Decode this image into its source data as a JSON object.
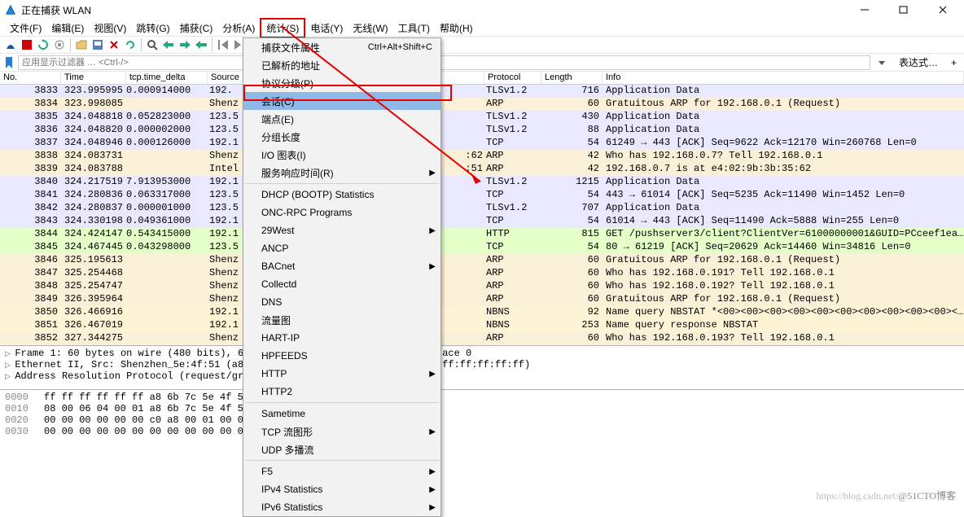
{
  "title": "正在捕获 WLAN",
  "menus": {
    "file": "文件(F)",
    "edit": "编辑(E)",
    "view": "视图(V)",
    "jump": "跳转(G)",
    "capture": "捕获(C)",
    "analyze": "分析(A)",
    "stats": "统计(S)",
    "telephony": "电话(Y)",
    "wireless": "无线(W)",
    "tools": "工具(T)",
    "help": "帮助(H)"
  },
  "filter_placeholder": "应用显示过滤器 … <Ctrl-/>",
  "expr_btn": "表达式…",
  "columns": {
    "no": "No.",
    "time": "Time",
    "delta": "tcp.time_delta",
    "src": "Source",
    "proto": "Protocol",
    "len": "Length",
    "info": "Info"
  },
  "dropdown": [
    {
      "label": "捕获文件属性",
      "shortcut": "Ctrl+Alt+Shift+C"
    },
    {
      "label": "已解析的地址"
    },
    {
      "label": "协议分级(P)"
    },
    {
      "label": "会话(C)",
      "sel": true,
      "hl": true
    },
    {
      "label": "端点(E)"
    },
    {
      "label": "分组长度"
    },
    {
      "label": "I/O 图表(I)"
    },
    {
      "label": "服务响应时间(R)",
      "sub": true,
      "sep_after": true
    },
    {
      "label": "DHCP (BOOTP) Statistics"
    },
    {
      "label": "ONC-RPC Programs"
    },
    {
      "label": "29West",
      "sub": true
    },
    {
      "label": "ANCP"
    },
    {
      "label": "BACnet",
      "sub": true
    },
    {
      "label": "Collectd"
    },
    {
      "label": "DNS"
    },
    {
      "label": "流量图"
    },
    {
      "label": "HART-IP"
    },
    {
      "label": "HPFEEDS"
    },
    {
      "label": "HTTP",
      "sub": true
    },
    {
      "label": "HTTP2"
    },
    {
      "label": "Sametime",
      "sep_before": true
    },
    {
      "label": "TCP 流图形",
      "sub": true
    },
    {
      "label": "UDP 多播流"
    },
    {
      "label": "F5",
      "sub": true,
      "sep_before": true
    },
    {
      "label": "IPv4 Statistics",
      "sub": true
    },
    {
      "label": "IPv6 Statistics",
      "sub": true
    }
  ],
  "rows": [
    {
      "no": "3833",
      "time": "323.995995",
      "delta": "0.000914000",
      "src": "192.",
      "srctail": "",
      "proto": "TLSv1.2",
      "len": "716",
      "info": "Application Data",
      "cls": "bg-tls"
    },
    {
      "no": "3834",
      "time": "323.998085",
      "delta": "",
      "src": "Shenz",
      "srctail": "",
      "proto": "ARP",
      "len": "60",
      "info": "Gratuitous ARP for 192.168.0.1 (Request)",
      "cls": "bg-arp"
    },
    {
      "no": "3835",
      "time": "324.048818",
      "delta": "0.052823000",
      "src": "123.5",
      "srctail": "",
      "proto": "TLSv1.2",
      "len": "430",
      "info": "Application Data",
      "cls": "bg-tls"
    },
    {
      "no": "3836",
      "time": "324.048820",
      "delta": "0.000002000",
      "src": "123.5",
      "srctail": "",
      "proto": "TLSv1.2",
      "len": "88",
      "info": "Application Data",
      "cls": "bg-tls"
    },
    {
      "no": "3837",
      "time": "324.048946",
      "delta": "0.000126000",
      "src": "192.1",
      "srctail": "",
      "proto": "TCP",
      "len": "54",
      "info": "61249 → 443 [ACK] Seq=9622 Ack=12170 Win=260768 Len=0",
      "cls": "bg-tcp"
    },
    {
      "no": "3838",
      "time": "324.083731",
      "delta": "",
      "src": "Shenz",
      "srctail": ":62",
      "proto": "ARP",
      "len": "42",
      "info": "Who has 192.168.0.7? Tell 192.168.0.1",
      "cls": "bg-arp"
    },
    {
      "no": "3839",
      "time": "324.083788",
      "delta": "",
      "src": "Intel",
      "srctail": ":51",
      "proto": "ARP",
      "len": "42",
      "info": "192.168.0.7 is at e4:02:9b:3b:35:62",
      "cls": "bg-arp"
    },
    {
      "no": "3840",
      "time": "324.217519",
      "delta": "7.913953000",
      "src": "192.1",
      "srctail": "",
      "proto": "TLSv1.2",
      "len": "1215",
      "info": "Application Data",
      "cls": "bg-tls"
    },
    {
      "no": "3841",
      "time": "324.280836",
      "delta": "0.063317000",
      "src": "123.5",
      "srctail": "",
      "proto": "TCP",
      "len": "54",
      "info": "443 → 61014 [ACK] Seq=5235 Ack=11490 Win=1452 Len=0",
      "cls": "bg-tcp"
    },
    {
      "no": "3842",
      "time": "324.280837",
      "delta": "0.000001000",
      "src": "123.5",
      "srctail": "",
      "proto": "TLSv1.2",
      "len": "707",
      "info": "Application Data",
      "cls": "bg-tls"
    },
    {
      "no": "3843",
      "time": "324.330198",
      "delta": "0.049361000",
      "src": "192.1",
      "srctail": "",
      "proto": "TCP",
      "len": "54",
      "info": "61014 → 443 [ACK] Seq=11490 Ack=5888 Win=255 Len=0",
      "cls": "bg-tcp"
    },
    {
      "no": "3844",
      "time": "324.424147",
      "delta": "0.543415000",
      "src": "192.1",
      "srctail": "",
      "proto": "HTTP",
      "len": "815",
      "info": "GET /pushserver3/client?ClientVer=61000000001&GUID=PCceef1ea…",
      "cls": "bg-http"
    },
    {
      "no": "3845",
      "time": "324.467445",
      "delta": "0.043298000",
      "src": "123.5",
      "srctail": "",
      "proto": "TCP",
      "len": "54",
      "info": "80 → 61219 [ACK] Seq=20629 Ack=14460 Win=34816 Len=0",
      "cls": "bg-http"
    },
    {
      "no": "3846",
      "time": "325.195613",
      "delta": "",
      "src": "Shenz",
      "srctail": "",
      "proto": "ARP",
      "len": "60",
      "info": "Gratuitous ARP for 192.168.0.1 (Request)",
      "cls": "bg-arp"
    },
    {
      "no": "3847",
      "time": "325.254468",
      "delta": "",
      "src": "Shenz",
      "srctail": "",
      "proto": "ARP",
      "len": "60",
      "info": "Who has 192.168.0.191? Tell 192.168.0.1",
      "cls": "bg-arp"
    },
    {
      "no": "3848",
      "time": "325.254747",
      "delta": "",
      "src": "Shenz",
      "srctail": "",
      "proto": "ARP",
      "len": "60",
      "info": "Who has 192.168.0.192? Tell 192.168.0.1",
      "cls": "bg-arp"
    },
    {
      "no": "3849",
      "time": "326.395964",
      "delta": "",
      "src": "Shenz",
      "srctail": "",
      "proto": "ARP",
      "len": "60",
      "info": "Gratuitous ARP for 192.168.0.1 (Request)",
      "cls": "bg-arp"
    },
    {
      "no": "3850",
      "time": "326.466916",
      "delta": "",
      "src": "192.1",
      "srctail": "",
      "proto": "NBNS",
      "len": "92",
      "info": "Name query NBSTAT *<00><00><00><00><00><00><00><00><00><00><…",
      "cls": "bg-nbns"
    },
    {
      "no": "3851",
      "time": "326.467019",
      "delta": "",
      "src": "192.1",
      "srctail": "",
      "proto": "NBNS",
      "len": "253",
      "info": "Name query response NBSTAT",
      "cls": "bg-nbns"
    },
    {
      "no": "3852",
      "time": "327.344275",
      "delta": "",
      "src": "Shenz",
      "srctail": "",
      "proto": "ARP",
      "len": "60",
      "info": "Who has 192.168.0.193? Tell 192.168.0.1",
      "cls": "bg-arp"
    }
  ],
  "details": {
    "l1": "Frame 1: 60 bytes on wire (480 bits), 6",
    "l1b": "ace 0",
    "l2": "Ethernet II, Src: Shenzhen_5e:4f:51 (a8",
    "l2b": "ff:ff:ff:ff:ff)",
    "l3": "Address Resolution Protocol (request/gr"
  },
  "hex": [
    {
      "off": "0000",
      "b": "ff ff ff ff ff ff a8 6b  7c 5e 4f 5",
      "a": ""
    },
    {
      "off": "0010",
      "b": "08 00 06 04 00 01 a8 6b  7c 5e 4f 5",
      "a": ""
    },
    {
      "off": "0020",
      "b": "00 00 00 00 00 00 c0 a8  00 01 00 0",
      "a": ""
    },
    {
      "off": "0030",
      "b": "00 00 00 00 00 00 00 00  00 00 00 0",
      "a": "······"
    }
  ],
  "watermark": {
    "csdn": "https://blog.csdn.net/",
    "cto": "@51CTO博客"
  }
}
